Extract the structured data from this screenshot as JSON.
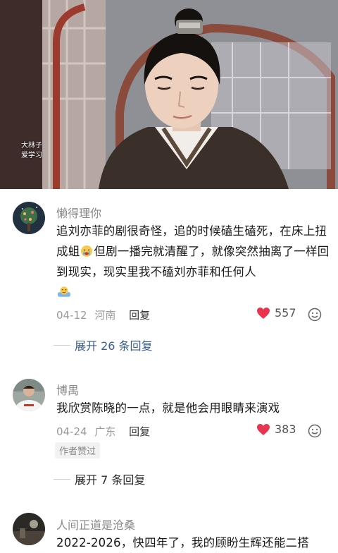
{
  "hero": {
    "watermark_line1": "大林子",
    "watermark_line2": "爱学习"
  },
  "comments": [
    {
      "username": "懒得理你",
      "text_part1": "追刘亦菲的剧很奇怪，追的时候磕生磕死，在床上扭成蛆",
      "text_part2": "但剧一播完就清醒了，就像突然抽离了一样回到现实，现实里我不磕刘亦菲和任何人",
      "date": "04-12",
      "location": "河南",
      "reply_label": "回复",
      "likes": "557",
      "expand_label": "展开 26 条回复"
    },
    {
      "username": "博禺",
      "text": "我欣赏陈晓的一点，就是他会用眼睛来演戏",
      "date": "04-24",
      "location": "广东",
      "reply_label": "回复",
      "likes": "383",
      "badge": "作者赞过",
      "expand_label": "展开 7 条回复"
    },
    {
      "username": "人间正道是沧桑",
      "text": "2022-2026，快四年了，我的顾盼生辉还能二搭"
    }
  ],
  "colors": {
    "like_red": "#e8344e",
    "link_blue": "#3a5d8f"
  }
}
